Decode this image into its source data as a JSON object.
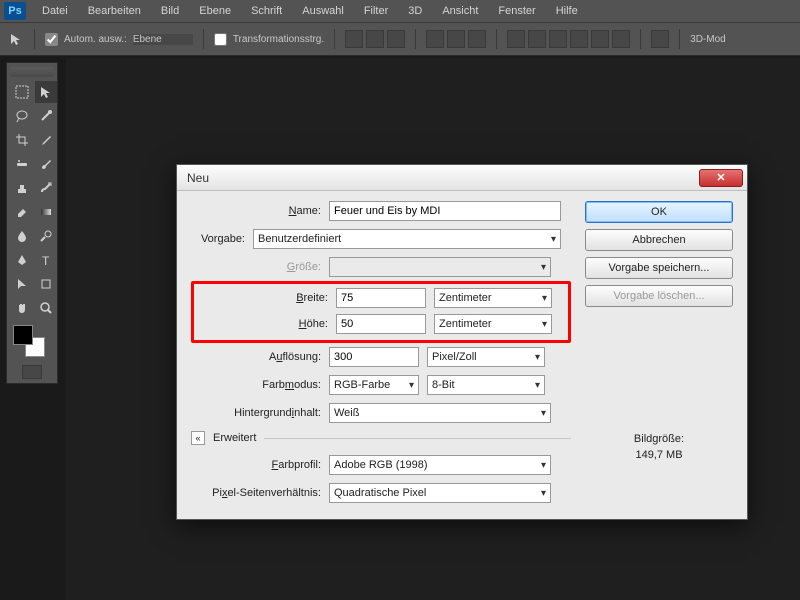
{
  "app": {
    "logo": "Ps"
  },
  "menu": [
    "Datei",
    "Bearbeiten",
    "Bild",
    "Ebene",
    "Schrift",
    "Auswahl",
    "Filter",
    "3D",
    "Ansicht",
    "Fenster",
    "Hilfe"
  ],
  "options": {
    "auto_select_label": "Autom. ausw.:",
    "auto_select_target": "Ebene",
    "transform_controls_label": "Transformationsstrg.",
    "mode3d_label": "3D-Mod"
  },
  "dialog": {
    "title": "Neu",
    "name_label": "Name:",
    "name_value": "Feuer und Eis by MDI",
    "preset_label": "Vorgabe:",
    "preset_value": "Benutzerdefiniert",
    "size_label": "Größe:",
    "width_label": "Breite:",
    "width_value": "75",
    "width_unit": "Zentimeter",
    "height_label": "Höhe:",
    "height_value": "50",
    "height_unit": "Zentimeter",
    "resolution_label": "Auflösung:",
    "resolution_value": "300",
    "resolution_unit": "Pixel/Zoll",
    "colormode_label": "Farbmodus:",
    "colormode_value": "RGB-Farbe",
    "colordepth_value": "8-Bit",
    "bgcontent_label": "Hintergrundinhalt:",
    "bgcontent_value": "Weiß",
    "advanced_label": "Erweitert",
    "colorprofile_label": "Farbprofil:",
    "colorprofile_value": "Adobe RGB (1998)",
    "pixelaspect_label": "Pixel-Seitenverhältnis:",
    "pixelaspect_value": "Quadratische Pixel",
    "ok_label": "OK",
    "cancel_label": "Abbrechen",
    "savepreset_label": "Vorgabe speichern...",
    "deletepreset_label": "Vorgabe löschen...",
    "imagesize_label": "Bildgröße:",
    "imagesize_value": "149,7 MB"
  }
}
